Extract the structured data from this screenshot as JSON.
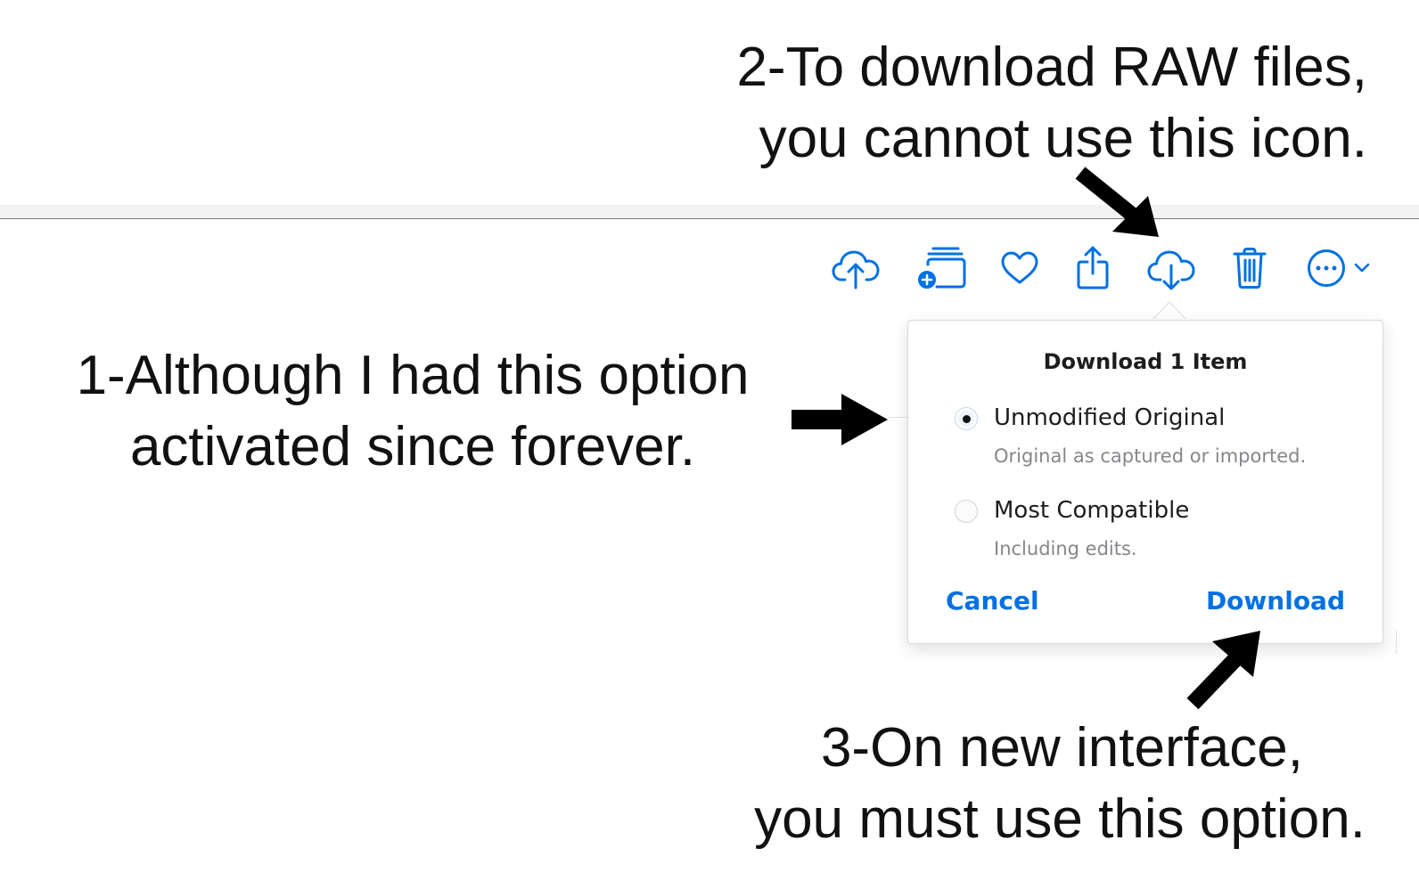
{
  "annotations": {
    "note1": {
      "line1": "1-Although I had this option",
      "line2": "activated since forever."
    },
    "note2": {
      "line1": "2-To download RAW files,",
      "line2": "you cannot use this icon."
    },
    "note3": {
      "line1": "3-On new interface,",
      "line2": "you must use this option."
    }
  },
  "toolbar": {
    "icons": [
      "upload-cloud-icon",
      "add-to-album-icon",
      "heart-icon",
      "share-icon",
      "download-cloud-icon",
      "trash-icon",
      "more-icon",
      "chevron-down-icon"
    ],
    "accent_color": "#0071e3"
  },
  "download_dialog": {
    "title": "Download 1 Item",
    "options": [
      {
        "label": "Unmodified Original",
        "description": "Original as captured or imported.",
        "selected": true
      },
      {
        "label": "Most Compatible",
        "description": "Including edits.",
        "selected": false
      }
    ],
    "cancel_label": "Cancel",
    "download_label": "Download"
  }
}
